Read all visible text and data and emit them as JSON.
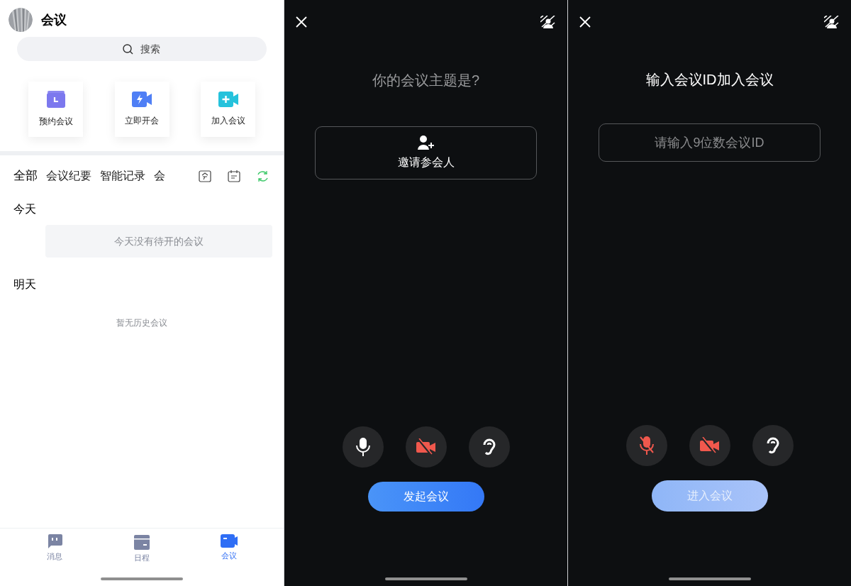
{
  "meetings_home": {
    "title": "会议",
    "search": {
      "placeholder": "搜索"
    },
    "quick_actions": [
      {
        "label": "预约会议",
        "kind": "schedule"
      },
      {
        "label": "立即开会",
        "kind": "start"
      },
      {
        "label": "加入会议",
        "kind": "join"
      }
    ],
    "tabs": [
      {
        "label": "全部",
        "selected": true
      },
      {
        "label": "会议纪要",
        "selected": false
      },
      {
        "label": "智能记录",
        "selected": false
      },
      {
        "label": "会",
        "selected": false
      }
    ],
    "sections": [
      {
        "heading": "今天",
        "empty_text": "今天没有待开的会议",
        "kind": "card"
      },
      {
        "heading": "明天",
        "empty_text": "暂无历史会议",
        "kind": "plain"
      }
    ],
    "bottom_nav": [
      {
        "label": "消息",
        "kind": "chat",
        "selected": false
      },
      {
        "label": "日程",
        "kind": "calendar",
        "selected": false
      },
      {
        "label": "会议",
        "kind": "meeting",
        "selected": true
      }
    ]
  },
  "start_meeting": {
    "topic_field": {
      "placeholder": "你的会议主题是?"
    },
    "invite_button": "邀请参会人",
    "toggles": [
      {
        "kind": "mic",
        "on": true
      },
      {
        "kind": "camera",
        "on": false
      },
      {
        "kind": "speaker",
        "on": true
      }
    ],
    "action": {
      "label": "发起会议",
      "disabled": false
    }
  },
  "join_meeting": {
    "title": "输入会议ID加入会议",
    "id_field": {
      "placeholder": "请输入9位数会议ID"
    },
    "toggles": [
      {
        "kind": "mic",
        "on": false
      },
      {
        "kind": "camera",
        "on": false
      },
      {
        "kind": "speaker",
        "on": true
      }
    ],
    "action": {
      "label": "进入会议",
      "disabled": true
    }
  }
}
